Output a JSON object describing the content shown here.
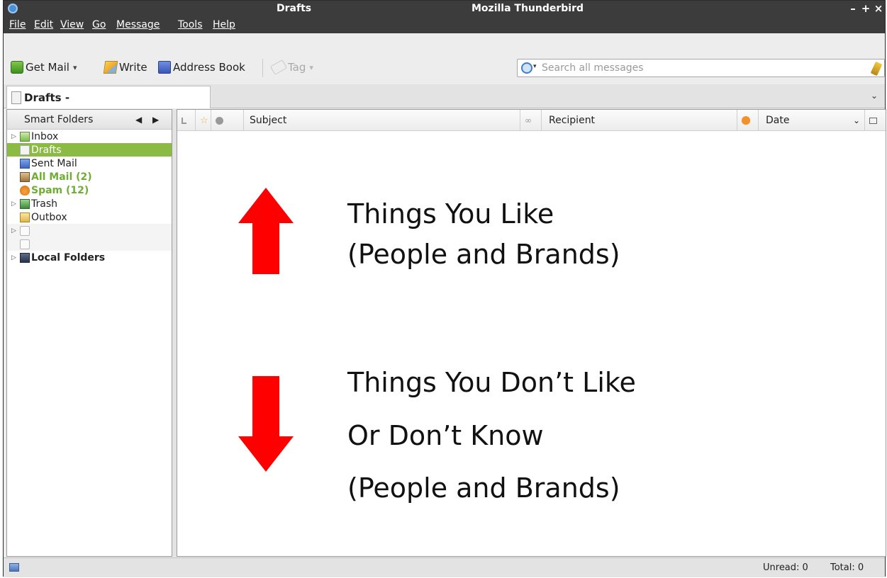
{
  "window": {
    "title_left": "Drafts",
    "title_center": "Mozilla Thunderbird",
    "controls": {
      "minimize": "–",
      "maximize": "+",
      "close": "×"
    }
  },
  "menu": {
    "items": [
      {
        "label": "File"
      },
      {
        "label": "Edit"
      },
      {
        "label": "View"
      },
      {
        "label": "Go"
      },
      {
        "label": "Message"
      },
      {
        "label": "Tools"
      },
      {
        "label": "Help"
      }
    ]
  },
  "toolbar": {
    "get_mail": "Get Mail",
    "write": "Write",
    "address_book": "Address Book",
    "tag": "Tag",
    "search_placeholder": "Search all messages"
  },
  "tabs": {
    "active_label": "Drafts -"
  },
  "folder_pane": {
    "header": "Smart Folders",
    "folders": [
      {
        "label": "Inbox",
        "icon": "inbox-icon"
      },
      {
        "label": "Drafts",
        "icon": "drafts-icon"
      },
      {
        "label": "Sent Mail",
        "icon": "sent-icon"
      },
      {
        "label": "All Mail (2)",
        "icon": "archive-icon"
      },
      {
        "label": "Spam (12)",
        "icon": "junk-icon"
      },
      {
        "label": "Trash",
        "icon": "trash-icon"
      },
      {
        "label": "Outbox",
        "icon": "outbox-icon"
      },
      {
        "label": "",
        "icon": "account-icon"
      },
      {
        "label": "",
        "icon": "account-icon"
      },
      {
        "label": "Local Folders",
        "icon": "local-folders-icon"
      }
    ]
  },
  "thread_pane": {
    "columns": {
      "subject": "Subject",
      "recipient": "Recipient",
      "date": "Date"
    }
  },
  "overlay": {
    "up_text_1": "Things You Like",
    "up_text_2": "(People and Brands)",
    "down_text_1": "Things You Don’t Like",
    "down_text_2": "Or Don’t Know",
    "down_text_3": "(People and Brands)",
    "arrow_color": "#ff0000"
  },
  "status": {
    "unread": "Unread: 0",
    "total": "Total: 0"
  },
  "colors": {
    "titlebar": "#3c3c3c",
    "selected_folder": "#8bbb45",
    "highlight_folder_text": "#6fae31"
  }
}
